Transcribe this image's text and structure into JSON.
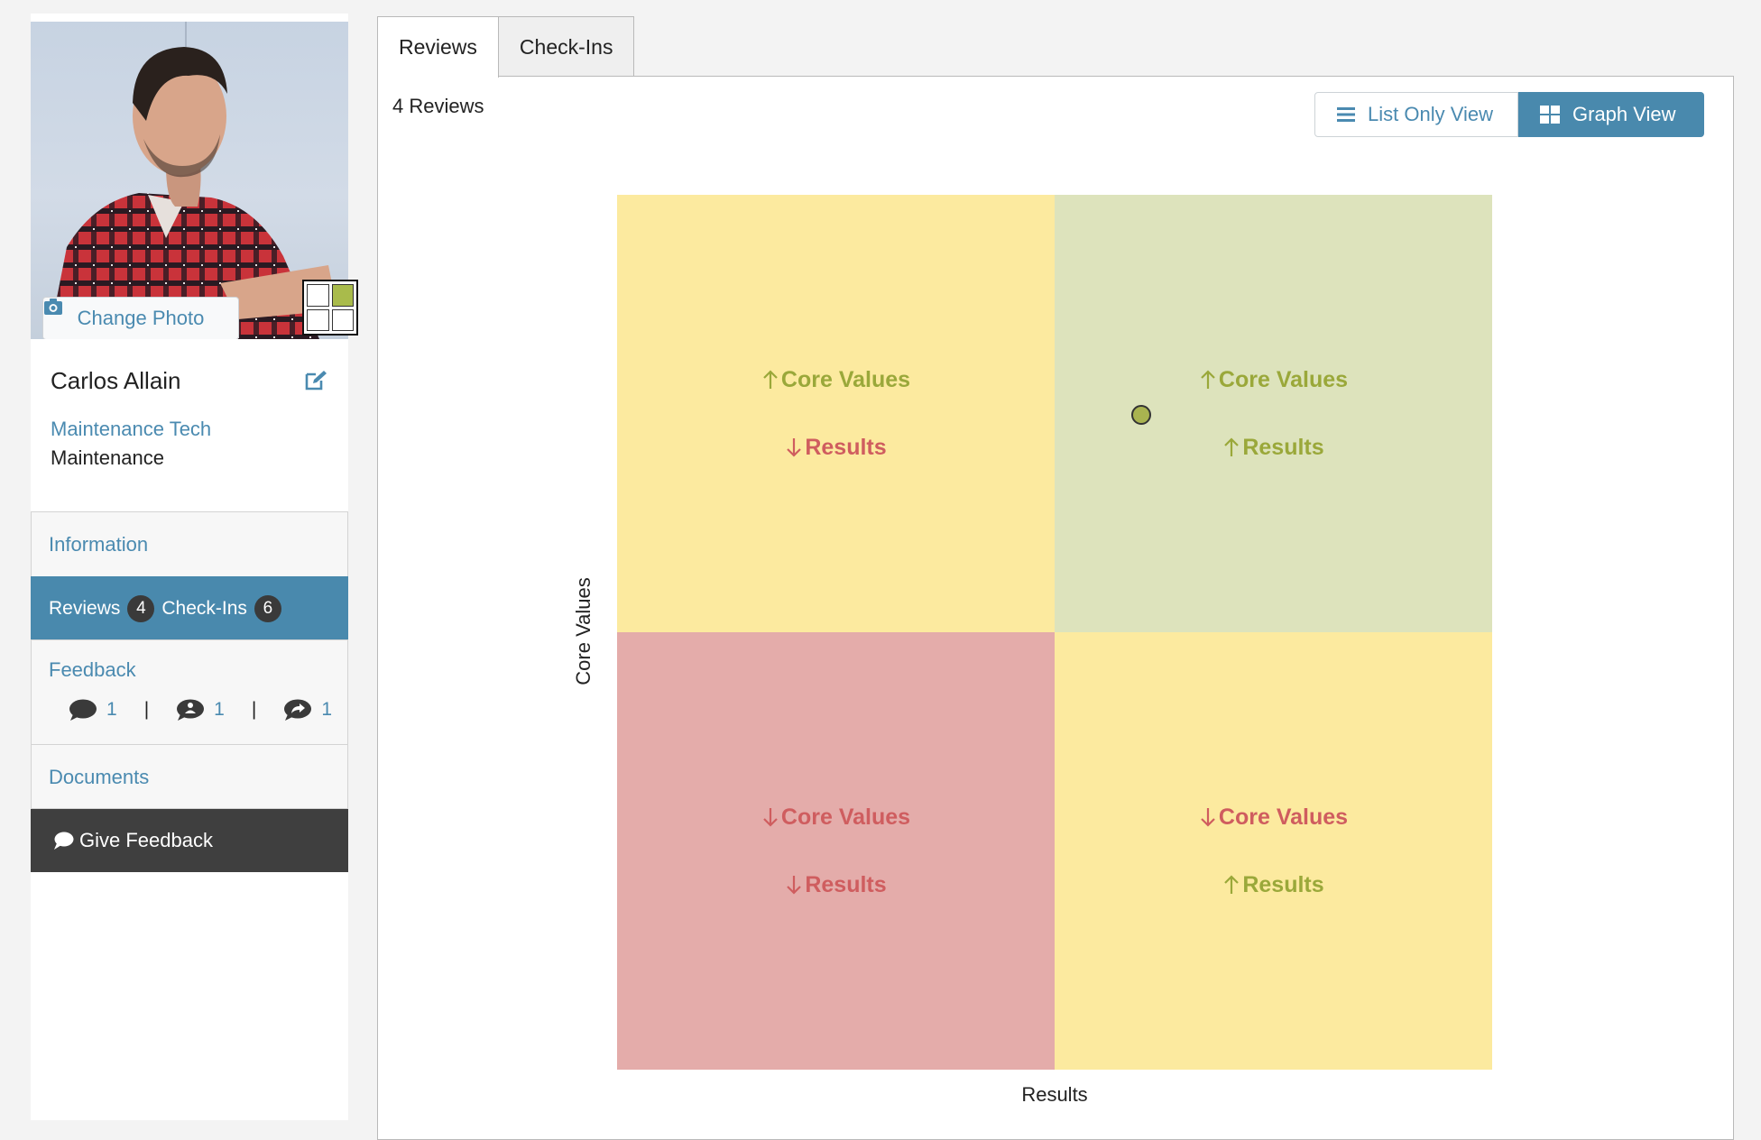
{
  "profile": {
    "change_photo_label": "Change Photo",
    "name": "Carlos Allain",
    "job_title": "Maintenance Tech",
    "department": "Maintenance"
  },
  "nav": {
    "information": "Information",
    "reviews_label": "Reviews",
    "reviews_count": "4",
    "checkins_label": "Check-Ins",
    "checkins_count": "6",
    "feedback_label": "Feedback",
    "feedback_counts": {
      "comments": "1",
      "private": "1",
      "shared": "1"
    },
    "feedback_separator": "|",
    "documents": "Documents",
    "give_feedback": "Give Feedback"
  },
  "tabs": [
    {
      "label": "Reviews",
      "active": true
    },
    {
      "label": "Check-Ins",
      "active": false
    }
  ],
  "main": {
    "review_count_label": "4 Reviews",
    "list_view_label": "List Only View",
    "graph_view_label": "Graph View"
  },
  "matrix": {
    "y_axis_label": "Core Values",
    "x_axis_label": "Results",
    "quadrants": {
      "top_left": {
        "line1": "Core Values",
        "line1_arrow": "up",
        "line2": "Results",
        "line2_arrow": "down"
      },
      "top_right": {
        "line1": "Core Values",
        "line1_arrow": "up",
        "line2": "Results",
        "line2_arrow": "up"
      },
      "bottom_left": {
        "line1": "Core Values",
        "line1_arrow": "down",
        "line2": "Results",
        "line2_arrow": "down"
      },
      "bottom_right": {
        "line1": "Core Values",
        "line1_arrow": "down",
        "line2": "Results",
        "line2_arrow": "up"
      }
    },
    "marker_quadrant": "top_right"
  },
  "colors": {
    "accent": "#4989ad",
    "green_text": "#9aa83a",
    "red_text": "#cf5d5f",
    "yellow_quadrant": "#fcea9f",
    "green_quadrant": "#dde3bc",
    "red_quadrant": "#e4acaa",
    "dark_button": "#3f3f3f"
  }
}
